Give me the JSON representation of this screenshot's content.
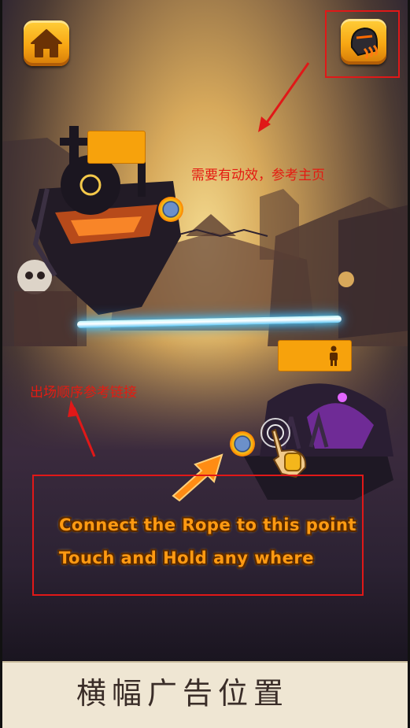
{
  "hud": {
    "home_icon": "home-icon",
    "helmet_icon": "helmet-icon"
  },
  "annotations": {
    "animation_note": "需要有动效，参考主页",
    "entrance_note": "出场顺序参考链接"
  },
  "tutorial": {
    "line1": "Connect the Rope to this point",
    "line2": "Touch and Hold any where",
    "hand_icon": "tap-hand-icon",
    "arrow_icon": "arrow-icon"
  },
  "character_badge_icon": "person-icon",
  "banner": {
    "text": "横幅广告位置"
  },
  "colors": {
    "annotation_red": "#e01818",
    "tutorial_orange": "#ff9a12",
    "hud_gold": "#f7a613",
    "rope_cyan": "#63c8f5",
    "banner_bg": "#efe6d3"
  }
}
